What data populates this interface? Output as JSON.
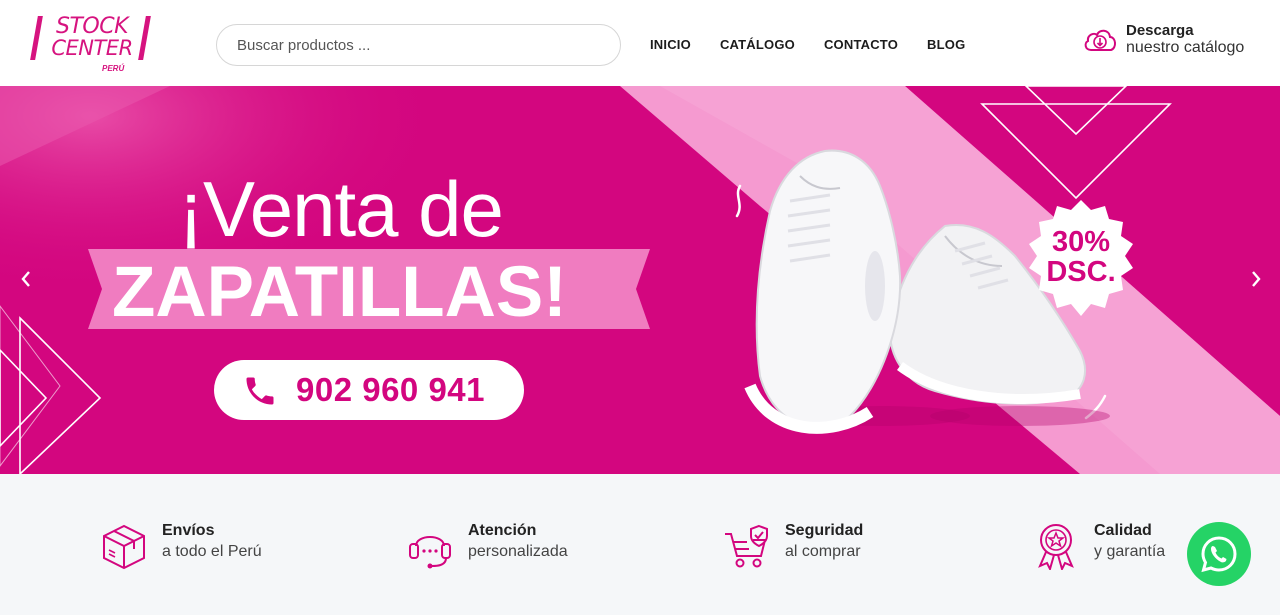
{
  "header": {
    "logo": {
      "line1": "STOCK",
      "line2": "CENTER",
      "sub": "PERÚ"
    },
    "search": {
      "placeholder": "Buscar productos ..."
    },
    "nav": [
      "INICIO",
      "CATÁLOGO",
      "CONTACTO",
      "BLOG"
    ],
    "download": {
      "title": "Descarga",
      "subtitle": "nuestro catálogo",
      "icon": "cloud-download-icon"
    }
  },
  "hero": {
    "line1": "¡Venta de",
    "line2": "ZAPATILLAS!",
    "phone": "902 960 941",
    "badge": {
      "line1": "30%",
      "line2": "DSC."
    },
    "colors": {
      "primary": "#d3067f",
      "light": "#f59ad0"
    }
  },
  "features": [
    {
      "title": "Envíos",
      "subtitle": "a todo el Perú",
      "icon": "box-icon"
    },
    {
      "title": "Atención",
      "subtitle": "personalizada",
      "icon": "headset-icon"
    },
    {
      "title": "Seguridad",
      "subtitle": "al comprar",
      "icon": "secure-cart-icon"
    },
    {
      "title": "Calidad",
      "subtitle": "y garantía",
      "icon": "quality-medal-icon"
    }
  ],
  "whatsapp": {
    "icon": "whatsapp-icon",
    "color": "#25d366"
  }
}
